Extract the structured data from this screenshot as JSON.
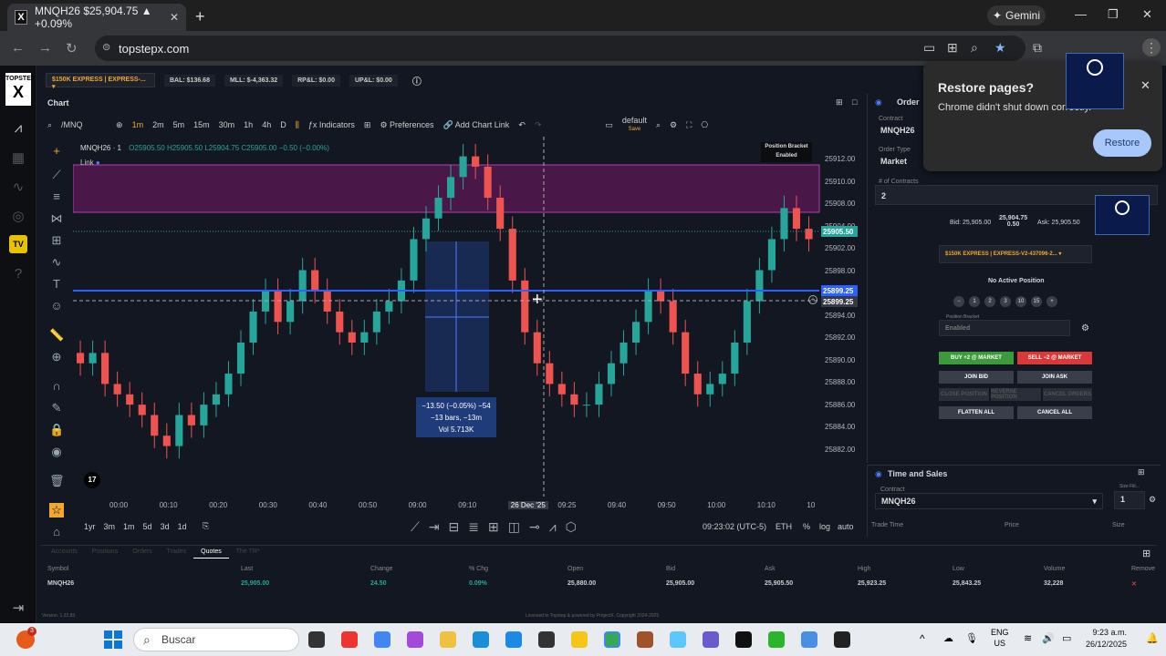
{
  "browser": {
    "tab_title": "MNQH26 $25,904.75 ▲ +0.09%",
    "url": "topstepx.com",
    "gemini_label": "Gemini"
  },
  "popup": {
    "title": "Restore pages?",
    "body": "Chrome didn't shut down correctly.",
    "restore_label": "Restore"
  },
  "logo": {
    "top": "TOPSTEP",
    "letter": "X"
  },
  "account_bar": {
    "account": "$150K EXPRESS | EXPRESS-...",
    "bal": "BAL: $136.68",
    "mll": "MLL: $-4,363.32",
    "rpnl": "RP&L: $0.00",
    "upnl": "UP&L: $0.00"
  },
  "chart_panel": {
    "title": "Chart",
    "symbol_search": "/MNQ",
    "timeframes": [
      "1m",
      "2m",
      "5m",
      "15m",
      "30m",
      "1h",
      "4h",
      "D"
    ],
    "selected_timeframe": "1m",
    "indicators_label": "Indicators",
    "preferences_label": "Preferences",
    "add_chart_link_label": "Add Chart Link",
    "layout_label": "default",
    "layout_sub": "Save"
  },
  "legend": {
    "symbol": "MNQH26 · 1",
    "ohlc": "O25905.50 H25905.50 L25904.75 C25905.00 −0.50 (−0.00%)",
    "link": "Link",
    "position_bracket": "Position Bracket",
    "position_bracket_state": "Enabled"
  },
  "measure": {
    "line1": "−13.50 (−0.05%) −54",
    "line2": "−13 bars, −13m",
    "line3": "Vol 5.713K"
  },
  "price_ticks": [
    "25912.00",
    "25910.00",
    "25908.00",
    "25904.00",
    "25902.00",
    "25898.00",
    "25896.00",
    "25894.00",
    "25892.00",
    "25890.00",
    "25888.00",
    "25886.00",
    "25884.00",
    "25882.00"
  ],
  "price_labels": {
    "last": "25905.50",
    "blue_line": "25899.25",
    "cursor": "25899.25"
  },
  "time_ticks": [
    "00:00",
    "00:10",
    "00:20",
    "00:30",
    "00:40",
    "00:50",
    "09:00",
    "09:10",
    "26 Dec '25",
    "09:25",
    "09:40",
    "09:50",
    "10:00",
    "10:10",
    "10"
  ],
  "bottom_toolbar": {
    "ranges": [
      "1yr",
      "3m",
      "1m",
      "5d",
      "3d",
      "1d"
    ],
    "clock": "09:23:02 (UTC-5)",
    "session": "ETH",
    "pct": "%",
    "log": "log",
    "auto": "auto"
  },
  "order_panel": {
    "title": "Order",
    "contract_label": "Contract",
    "contract": "MNQH26",
    "order_type_label": "Order Type",
    "order_type": "Market",
    "contracts_label": "# of Contracts",
    "contracts": "2",
    "bid": "Bid: 25,905.00",
    "mid": "25,904.75",
    "spread": "0.50",
    "ask": "Ask: 25,905.50",
    "account": "$150K EXPRESS | EXPRESS-V2-437096-2...",
    "no_position": "No Active Position",
    "qty_buttons": [
      "−",
      "1",
      "2",
      "3",
      "10",
      "15",
      "+"
    ],
    "bracket_label": "Position Bracket",
    "bracket_value": "Enabled",
    "buy_label": "BUY +2 @ MARKET",
    "sell_label": "SELL −2 @ MARKET",
    "join_bid": "JOIN BID",
    "join_ask": "JOIN ASK",
    "close_position": "CLOSE POSITION",
    "reverse_position": "REVERSE POSITION",
    "cancel_orders": "CANCEL ORDERS",
    "flatten_all": "FLATTEN ALL",
    "cancel_all": "CANCEL ALL"
  },
  "time_sales": {
    "title": "Time and Sales",
    "contract_label": "Contract",
    "contract": "MNQH26",
    "size_filter_label": "Size Filt...",
    "size_filter": "1",
    "columns": [
      "Trade Time",
      "Price",
      "Size"
    ]
  },
  "bottom_panel": {
    "tabs": [
      "Accounts",
      "Positions",
      "Orders",
      "Trades",
      "Quotes",
      "The TR*"
    ],
    "active_tab": "Quotes",
    "columns": [
      "Symbol",
      "Last",
      "Change",
      "% Chg",
      "Open",
      "Bid",
      "Ask",
      "High",
      "Low",
      "Volume",
      "Remove"
    ],
    "row": [
      "MNQH26",
      "25,905.00",
      "24.50",
      "0.09%",
      "25,880.00",
      "25,905.00",
      "25,905.50",
      "25,923.25",
      "25,843.25",
      "32,228"
    ],
    "version": "Version: 1.22.83",
    "license": "Licensed to Topstep & powered by ProjectX. Copyright 2024-2025"
  },
  "taskbar": {
    "search": "Buscar",
    "lang1": "ENG",
    "lang2": "US",
    "time": "9:23 a.m.",
    "date": "26/12/2025",
    "badge": "3"
  },
  "colors": {
    "up": "#26a69a",
    "down": "#ef5350",
    "zone": "#5a1a5a",
    "blue_line": "#2962ff",
    "accent": "#f0a830"
  },
  "chart_data": {
    "type": "candlestick",
    "series_name": "MNQH26",
    "y_range": [
      25881,
      25913
    ],
    "closes": [
      25893,
      25894,
      25891,
      25890,
      25889,
      25888,
      25886,
      25885,
      25888,
      25887,
      25889,
      25890,
      25892,
      25895,
      25898,
      25900,
      25897,
      25899,
      25902,
      25900,
      25898,
      25896,
      25895,
      25896,
      25898,
      25899,
      25901,
      25905,
      25907,
      25909,
      25911,
      25913,
      25912,
      25909,
      25906,
      25901,
      25896,
      25893,
      25891,
      25890,
      25889,
      25889,
      25891,
      25893,
      25895,
      25897,
      25900,
      25899,
      25896,
      25892,
      25890,
      25891,
      25892,
      25895,
      25899,
      25902,
      25905,
      25908,
      25906,
      25905
    ],
    "notes": "Approximate 1-minute candle closes read from visible chart"
  }
}
